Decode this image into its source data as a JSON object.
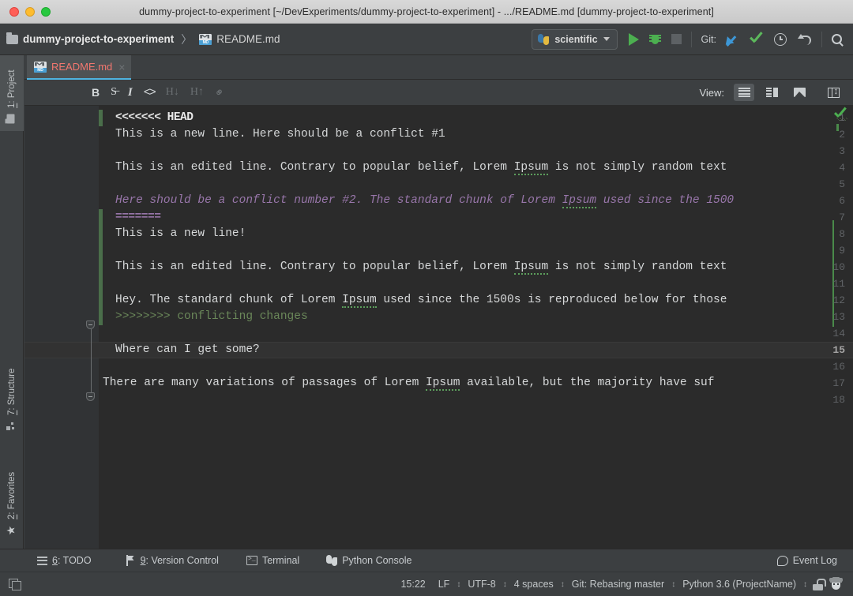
{
  "window": {
    "title": "dummy-project-to-experiment [~/DevExperiments/dummy-project-to-experiment] - .../README.md [dummy-project-to-experiment]"
  },
  "toolbar": {
    "breadcrumb_project": "dummy-project-to-experiment",
    "breadcrumb_separator": "〉",
    "breadcrumb_file": "README.md",
    "run_config": "scientific",
    "git_label": "Git:",
    "icons": {
      "run": "run-icon",
      "debug": "debug-icon",
      "stop": "stop-icon",
      "update_project": "update-project-icon",
      "commit": "commit-checkmark-icon",
      "history": "history-clock-icon",
      "rollback": "rollback-icon",
      "search": "search-everywhere-icon"
    }
  },
  "sidebar": {
    "tabs": [
      {
        "label": "1: Project",
        "num": "1",
        "rest": ": Project",
        "icon": "project-folder-icon",
        "selected": true
      },
      {
        "label": "7: Structure",
        "num": "7",
        "rest": ": Structure",
        "icon": "structure-icon",
        "selected": false
      },
      {
        "label": "2: Favorites",
        "num": "2",
        "rest": ": Favorites",
        "icon": "star-icon",
        "selected": false
      }
    ]
  },
  "editor_tabs": [
    {
      "label": "README.md",
      "icon": "markdown-file-icon",
      "close": "×",
      "active": true
    }
  ],
  "markdown_toolbar": {
    "buttons": [
      {
        "name": "bold-button",
        "glyph": "B",
        "cls": "bold",
        "enabled": true
      },
      {
        "name": "strikethrough-button",
        "glyph": "S̶",
        "cls": "strike",
        "enabled": true
      },
      {
        "name": "italic-button",
        "glyph": "I",
        "cls": "ital",
        "enabled": true
      },
      {
        "name": "code-button",
        "glyph": "<>",
        "cls": "code",
        "enabled": true
      },
      {
        "name": "header-down-button",
        "glyph": "H↓",
        "cls": "dim",
        "enabled": false
      },
      {
        "name": "header-up-button",
        "glyph": "H↑",
        "cls": "dim",
        "enabled": false
      },
      {
        "name": "link-button",
        "glyph": "⚭",
        "cls": "link",
        "enabled": false
      }
    ],
    "view_label": "View:",
    "view_buttons": [
      {
        "name": "view-editor-only-button",
        "kind": "lines",
        "active": true
      },
      {
        "name": "view-editor-preview-button",
        "kind": "split",
        "active": false
      },
      {
        "name": "view-preview-only-button",
        "kind": "image",
        "active": false
      },
      {
        "name": "view-sync-scroll-button",
        "kind": "sync",
        "active": false
      }
    ]
  },
  "code": {
    "current_line": 15,
    "line_numbers": [
      "1",
      "2",
      "3",
      "4",
      "5",
      "6",
      "7",
      "8",
      "9",
      "10",
      "11",
      "12",
      "13",
      "14",
      "15",
      "16",
      "17",
      "18"
    ],
    "lines": [
      {
        "n": 1,
        "text": "<<<<<<< HEAD",
        "style": "conflict-marker"
      },
      {
        "n": 2,
        "text": "This is a new line. Here should be a conflict #1",
        "style": "plain"
      },
      {
        "n": 3,
        "text": "",
        "style": "plain"
      },
      {
        "n": 4,
        "text": "This is an edited line. Contrary to popular belief, Lorem Ipsum is not simply random text",
        "style": "plain",
        "spell": "Ipsum"
      },
      {
        "n": 5,
        "text": "",
        "style": "plain"
      },
      {
        "n": 6,
        "text": "Here should be a conflict number #2. The standard chunk of Lorem Ipsum used since the 1500",
        "style": "ital",
        "spell": "Ipsum"
      },
      {
        "n": 7,
        "text": "=======",
        "style": "sep-marker"
      },
      {
        "n": 8,
        "text": "This is a new line!",
        "style": "plain"
      },
      {
        "n": 9,
        "text": "",
        "style": "plain"
      },
      {
        "n": 10,
        "text": "This is an edited line. Contrary to popular belief, Lorem Ipsum is not simply random text",
        "style": "plain",
        "spell": "Ipsum"
      },
      {
        "n": 11,
        "text": "",
        "style": "plain"
      },
      {
        "n": 12,
        "text": "Hey. The standard chunk of Lorem Ipsum used since the 1500s is reproduced below for those",
        "style": "plain",
        "spell": "Ipsum"
      },
      {
        "n": 13,
        "text": ">>>>>>>> conflicting changes",
        "style": "green"
      },
      {
        "n": 14,
        "text": "",
        "style": "plain"
      },
      {
        "n": 15,
        "text": "Where can I get some?",
        "style": "plain"
      },
      {
        "n": 16,
        "text": "",
        "style": "plain"
      },
      {
        "n": 17,
        "text": "There are many variations of passages of Lorem Ipsum available, but the majority have suf",
        "style": "plain",
        "spell": "Ipsum"
      },
      {
        "n": 18,
        "text": "",
        "style": "plain"
      }
    ],
    "inspection_status": "ok-checkmark"
  },
  "bottom_tool_window": {
    "items": [
      {
        "name": "todo",
        "num": "6",
        "rest": ": TODO",
        "icon": "todo-list-icon"
      },
      {
        "name": "version-control",
        "num": "9",
        "rest": ": Version Control",
        "icon": "branch-icon"
      },
      {
        "name": "terminal",
        "num": "",
        "rest": "Terminal",
        "icon": "terminal-icon"
      },
      {
        "name": "python-console",
        "num": "",
        "rest": "Python Console",
        "icon": "python-icon"
      }
    ],
    "event_log": "Event Log",
    "event_log_icon": "event-log-icon"
  },
  "status_bar": {
    "toggle_icon": "toggle-tool-windows-icon",
    "caret_position": "15:22",
    "line_separator": "LF",
    "encoding": "UTF-8",
    "indent": "4 spaces",
    "vcs": "Git: Rebasing master",
    "interpreter": "Python 3.6 (ProjectName)",
    "lock_icon": "unlocked-icon",
    "hector_icon": "hector-inspection-icon",
    "arrows": "↕"
  },
  "colors": {
    "accent_tab_underline": "#4eb3e0",
    "tab_filename": "#f2776f",
    "editor_bg": "#2b2b2b",
    "gutter_bg": "#313335",
    "chrome_bg": "#3c3f41",
    "conflict_purple": "#9876aa",
    "conflict_green": "#6a8759",
    "change_marker_green": "#4a6e4a",
    "run_green": "#4caf50",
    "git_blue": "#3d97d6",
    "spellcheck_green": "#5c9e5c"
  }
}
